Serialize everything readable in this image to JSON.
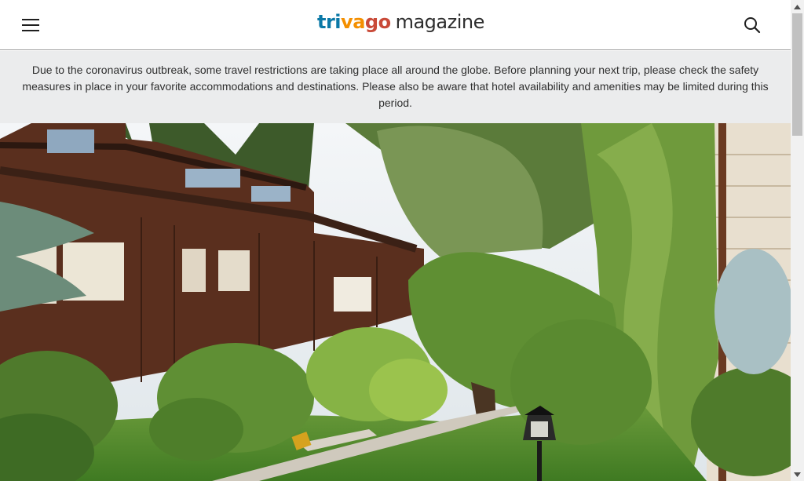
{
  "header": {
    "menu_icon": "hamburger-menu-icon",
    "logo": {
      "part1": "tri",
      "part2": "va",
      "part3": "go",
      "part4": "magazine"
    },
    "search_icon": "search-icon"
  },
  "notice": {
    "text": "Due to the coronavirus outbreak, some travel restrictions are taking place all around the globe. Before planning your next trip, please check the safety measures in place in your favorite accommodations and destinations. Please also be aware that hotel availability and amenities may be limited during this period."
  },
  "hero": {
    "image_icon": "hotel-courtyard-photo"
  },
  "colors": {
    "logo_blue": "#0b79a7",
    "logo_orange": "#f48f00",
    "logo_red": "#c94a38",
    "notice_bg": "#ebeced"
  },
  "scrollbar": {
    "up_icon": "scroll-up-arrow-icon",
    "down_icon": "scroll-down-arrow-icon"
  }
}
